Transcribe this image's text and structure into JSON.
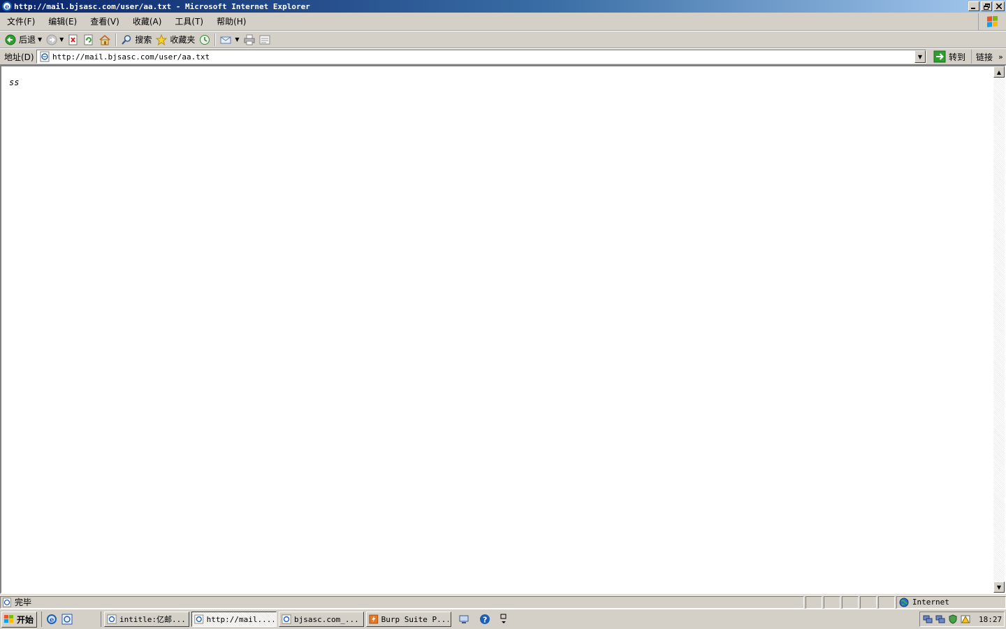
{
  "window": {
    "title": "http://mail.bjsasc.com/user/aa.txt - Microsoft Internet Explorer",
    "controls": [
      "minimize",
      "restore",
      "close"
    ]
  },
  "menubar": {
    "items": [
      "文件(F)",
      "编辑(E)",
      "查看(V)",
      "收藏(A)",
      "工具(T)",
      "帮助(H)"
    ]
  },
  "toolbar": {
    "back_label": "后退",
    "search_label": "搜索",
    "favorites_label": "收藏夹"
  },
  "address": {
    "label": "地址(D)",
    "url": "http://mail.bjsasc.com/user/aa.txt",
    "go_label": "转到",
    "links_label": "链接"
  },
  "page": {
    "content": "ss"
  },
  "status": {
    "text": "完毕",
    "zone": "Internet"
  },
  "taskbar": {
    "start_label": "开始",
    "tasks": [
      {
        "label": "intitle:亿邮...",
        "active": false
      },
      {
        "label": "http://mail....",
        "active": true
      },
      {
        "label": "bjsasc.com_...",
        "active": false
      },
      {
        "label": "Burp Suite P...",
        "active": false
      }
    ],
    "clock": "18:27"
  },
  "colors": {
    "titlebar_start": "#0a246a",
    "titlebar_end": "#a6caf0",
    "chrome": "#d4d0c8"
  }
}
